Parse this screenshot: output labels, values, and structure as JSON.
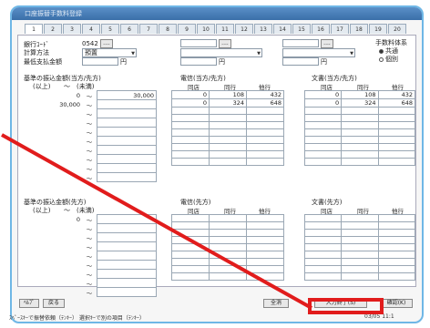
{
  "window": {
    "title": "口座振替手数料登録"
  },
  "tabs": [
    "1",
    "2",
    "3",
    "4",
    "5",
    "6",
    "7",
    "8",
    "9",
    "10",
    "11",
    "12",
    "13",
    "14",
    "15",
    "16",
    "17",
    "18",
    "19",
    "20"
  ],
  "form": {
    "bank_code_label": "銀行ｺｰﾄﾞ",
    "bank_code_value": "0542",
    "lookup_btn": "....",
    "calc_label": "計算方法",
    "calc_value": "預置",
    "min_payment_label": "最低支払金額",
    "yen": "円",
    "fee_entity_label": "手数料体系",
    "fee_common": "共通",
    "fee_individual": "個別"
  },
  "sections": {
    "upper_left": "基準の振込金額(当方/先方)",
    "upper_mid": "電信(当方/先方)",
    "upper_right": "文書(当方/先方)",
    "lower_left": "基準の振込金額(先方)",
    "lower_mid": "電信(先方)",
    "lower_right": "文書(先方)",
    "over_label": "(以上)",
    "under_label": "(未満)",
    "tilde": "〜",
    "col_same_branch": "同店",
    "col_same_bank": "同行",
    "col_other_bank": "他行"
  },
  "upper_amount_rows": [
    {
      "from": "0",
      "to": "30,000"
    },
    {
      "from": "30,000",
      "to": ""
    }
  ],
  "upper_telegraph_rows": [
    [
      "0",
      "108",
      "432"
    ],
    [
      "0",
      "324",
      "648"
    ]
  ],
  "upper_document_rows": [
    [
      "0",
      "108",
      "432"
    ],
    [
      "0",
      "324",
      "648"
    ]
  ],
  "lower_amount_rows": [
    {
      "from": "0",
      "to": ""
    }
  ],
  "buttons": {
    "help": "ﾍﾙﾌﾟ",
    "back": "戻る",
    "clear_all": "全消",
    "finish_input": "入力終了(S)",
    "confirm": "確認(K)"
  },
  "status": {
    "left": "ｽﾍﾟｰｽｷｰで振替依頼（ﾃﾝｷｰ）  選択ｷｰで別の項目（ﾃﾝｷｰ）",
    "right": "03/05 11:1"
  }
}
